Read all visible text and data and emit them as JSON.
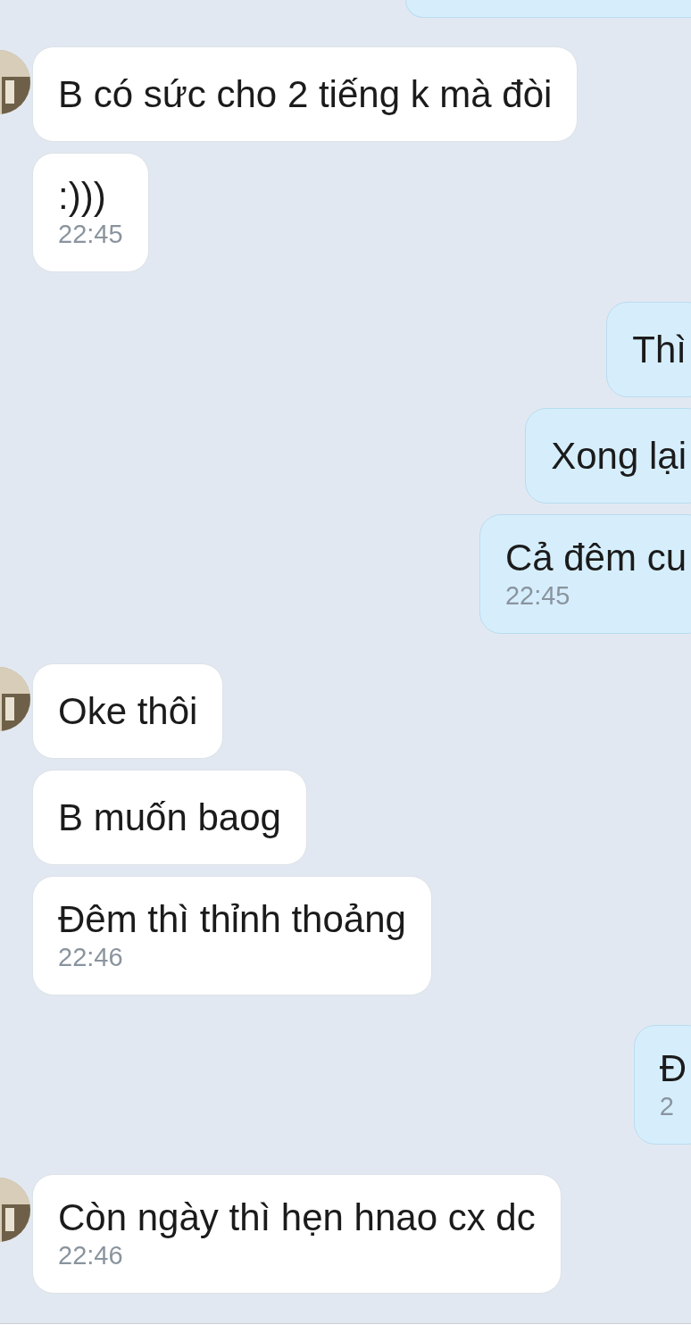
{
  "groups": [
    {
      "kind": "received",
      "messages": [
        {
          "text": "B có sức cho 2 tiếng k mà đòi"
        },
        {
          "text": ":)))",
          "time": "22:45"
        }
      ]
    },
    {
      "kind": "sent",
      "messages": [
        {
          "text": "Thì"
        },
        {
          "text": "Xong lại"
        },
        {
          "text": "Cả đêm cu",
          "time": "22:45"
        }
      ]
    },
    {
      "kind": "received",
      "messages": [
        {
          "text": "Oke thôi"
        },
        {
          "text": "B muốn baog"
        },
        {
          "text": "Đêm thì thỉnh thoảng",
          "time": "22:46"
        }
      ]
    },
    {
      "kind": "sent",
      "messages": [
        {
          "text": "Đ",
          "time": "2"
        }
      ]
    },
    {
      "kind": "received",
      "messages": [
        {
          "text": "Còn ngày thì hẹn hnao cx dc",
          "time": "22:46"
        }
      ]
    }
  ]
}
